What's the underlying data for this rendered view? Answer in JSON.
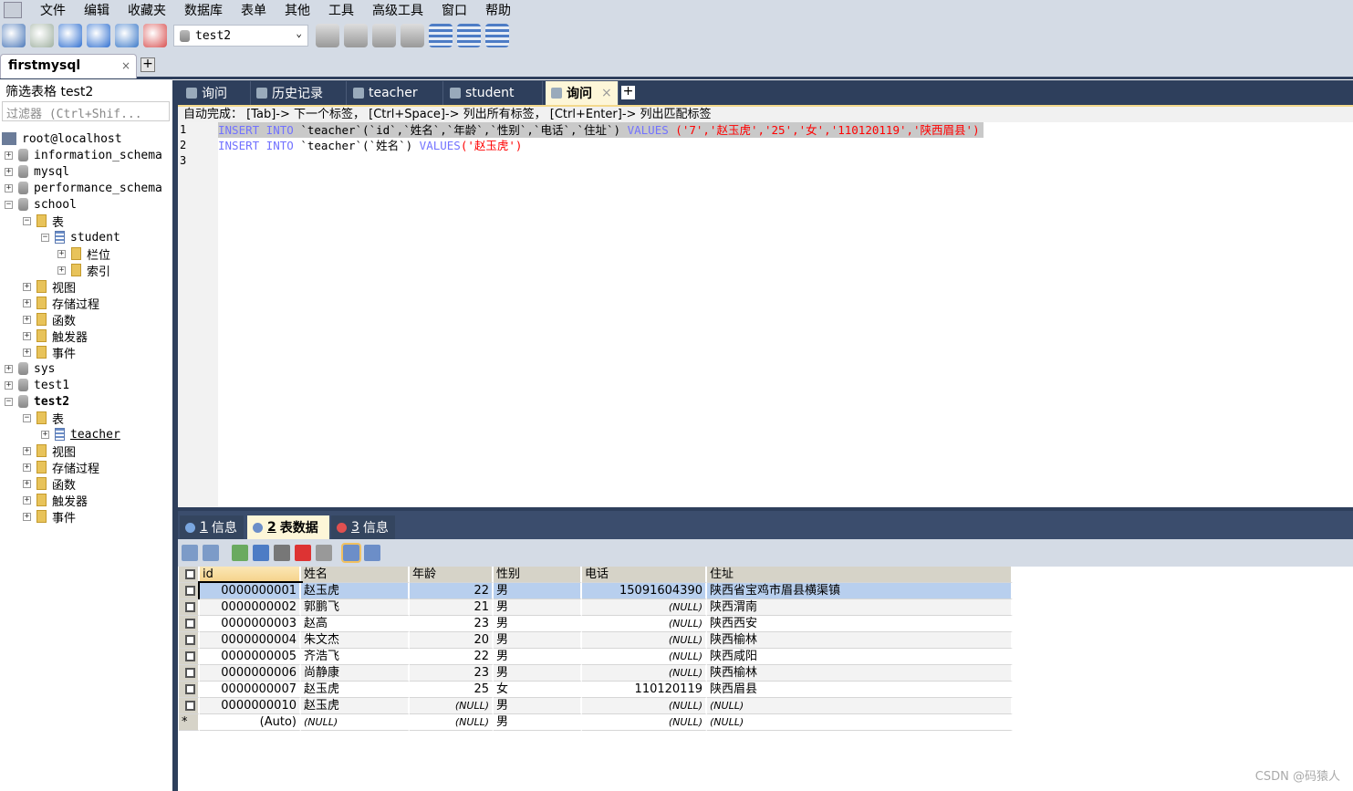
{
  "menu": [
    "文件",
    "编辑",
    "收藏夹",
    "数据库",
    "表单",
    "其他",
    "工具",
    "高级工具",
    "窗口",
    "帮助"
  ],
  "toolbar": {
    "icons": [
      "connect-icon",
      "new-query-icon",
      "execute-icon",
      "execute-all-icon",
      "stop-icon",
      "schema-designer-icon"
    ],
    "db_selected": "test2",
    "icons2": [
      "user-manager-icon",
      "backup-icon",
      "restore-icon",
      "import-icon",
      "export-grid-icon",
      "table-data-icon",
      "table-key-icon"
    ]
  },
  "connection": {
    "tab": "firstmysql",
    "close": "×",
    "add": "+"
  },
  "left": {
    "filter_label": "筛选表格 test2",
    "filter_placeholder": "过滤器 (Ctrl+Shif..."
  },
  "tree": [
    {
      "label": "root@localhost",
      "level": 0,
      "icon": "server",
      "exp": ""
    },
    {
      "label": "information_schema",
      "level": 0,
      "icon": "db",
      "exp": "+"
    },
    {
      "label": "mysql",
      "level": 0,
      "icon": "db",
      "exp": "+"
    },
    {
      "label": "performance_schema",
      "level": 0,
      "icon": "db",
      "exp": "+"
    },
    {
      "label": "school",
      "level": 0,
      "icon": "db",
      "exp": "−"
    },
    {
      "label": "表",
      "level": 1,
      "icon": "folder",
      "exp": "−"
    },
    {
      "label": "student",
      "level": 2,
      "icon": "table",
      "exp": "−"
    },
    {
      "label": "栏位",
      "level": 3,
      "icon": "folder",
      "exp": "+"
    },
    {
      "label": "索引",
      "level": 3,
      "icon": "folder",
      "exp": "+"
    },
    {
      "label": "视图",
      "level": 1,
      "icon": "folder",
      "exp": "+"
    },
    {
      "label": "存储过程",
      "level": 1,
      "icon": "folder",
      "exp": "+"
    },
    {
      "label": "函数",
      "level": 1,
      "icon": "folder",
      "exp": "+"
    },
    {
      "label": "触发器",
      "level": 1,
      "icon": "folder",
      "exp": "+"
    },
    {
      "label": "事件",
      "level": 1,
      "icon": "folder",
      "exp": "+"
    },
    {
      "label": "sys",
      "level": 0,
      "icon": "db",
      "exp": "+"
    },
    {
      "label": "test1",
      "level": 0,
      "icon": "db",
      "exp": "+"
    },
    {
      "label": "test2",
      "level": 0,
      "icon": "db",
      "exp": "−",
      "bold": true
    },
    {
      "label": "表",
      "level": 1,
      "icon": "folder",
      "exp": "−"
    },
    {
      "label": "teacher",
      "level": 2,
      "icon": "table",
      "exp": "+",
      "underline": true
    },
    {
      "label": "视图",
      "level": 1,
      "icon": "folder",
      "exp": "+"
    },
    {
      "label": "存储过程",
      "level": 1,
      "icon": "folder",
      "exp": "+"
    },
    {
      "label": "函数",
      "level": 1,
      "icon": "folder",
      "exp": "+"
    },
    {
      "label": "触发器",
      "level": 1,
      "icon": "folder",
      "exp": "+"
    },
    {
      "label": "事件",
      "level": 1,
      "icon": "folder",
      "exp": "+"
    }
  ],
  "editor_tabs": [
    {
      "label": "询问"
    },
    {
      "label": "历史记录"
    },
    {
      "label": "teacher"
    },
    {
      "label": "student"
    },
    {
      "label": "询问",
      "active": true,
      "close": "×"
    }
  ],
  "editor_tab_add": "+",
  "hint": "自动完成： [Tab]-> 下一个标签， [Ctrl+Space]-> 列出所有标签， [Ctrl+Enter]-> 列出匹配标签",
  "code": [
    {
      "n": "1",
      "parts": [
        [
          "kw",
          "INSERT INTO "
        ],
        [
          "",
          "`teacher`(`id`,`姓名`,`年龄`,`性别`,`电话`,`住址`) "
        ],
        [
          "kw",
          "VALUES "
        ],
        [
          "str",
          "('7','赵玉虎','25','女','110120119','陕西眉县')"
        ]
      ],
      "selected": true
    },
    {
      "n": "2",
      "parts": [
        [
          "kw",
          "INSERT INTO "
        ],
        [
          "",
          "`teacher`(`姓名`) "
        ],
        [
          "kw",
          "VALUES"
        ],
        [
          "str",
          "('赵玉虎')"
        ]
      ]
    },
    {
      "n": "3",
      "parts": []
    }
  ],
  "result_tabs": [
    {
      "num": "1",
      "label": "信息"
    },
    {
      "num": "2",
      "label": "表数据",
      "active": true
    },
    {
      "num": "3",
      "label": "信息"
    }
  ],
  "grid": {
    "columns": [
      "id",
      "姓名",
      "年龄",
      "性别",
      "电话",
      "住址"
    ],
    "rows": [
      [
        "0000000001",
        "赵玉虎",
        "22",
        "男",
        "15091604390",
        "陕西省宝鸡市眉县横渠镇"
      ],
      [
        "0000000002",
        "郭鹏飞",
        "21",
        "男",
        "(NULL)",
        "陕西渭南"
      ],
      [
        "0000000003",
        "赵高",
        "23",
        "男",
        "(NULL)",
        "陕西西安"
      ],
      [
        "0000000004",
        "朱文杰",
        "20",
        "男",
        "(NULL)",
        "陕西榆林"
      ],
      [
        "0000000005",
        "齐浩飞",
        "22",
        "男",
        "(NULL)",
        "陕西咸阳"
      ],
      [
        "0000000006",
        "尚静康",
        "23",
        "男",
        "(NULL)",
        "陕西榆林"
      ],
      [
        "0000000007",
        "赵玉虎",
        "25",
        "女",
        "110120119",
        "陕西眉县"
      ],
      [
        "0000000010",
        "赵玉虎",
        "(NULL)",
        "男",
        "(NULL)",
        "(NULL)"
      ],
      [
        "(Auto)",
        "(NULL)",
        "(NULL)",
        "男",
        "(NULL)",
        "(NULL)"
      ]
    ],
    "new_row_marker": "*",
    "selected_row": 0
  },
  "watermark": "CSDN @码猿人"
}
